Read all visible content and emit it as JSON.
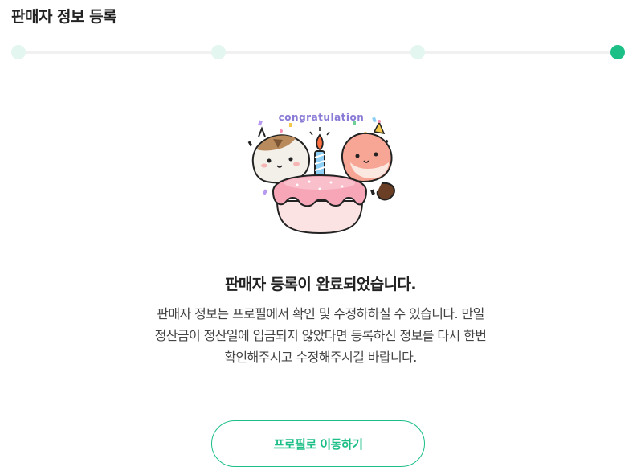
{
  "header": {
    "title": "판매자 정보 등록"
  },
  "stepper": {
    "total_steps": 4,
    "current_step": 4,
    "active_color": "#1cbf86",
    "inactive_color": "#e3f6ef"
  },
  "illustration": {
    "banner_text": "congratulation",
    "icon": "celebration-cake-with-two-hamsters"
  },
  "result": {
    "title": "판매자 등록이 완료되었습니다.",
    "description_lines": [
      "판매자 정보는 프로필에서 확인 및 수정하하실 수 있습니다. 만일",
      "정산금이 정산일에 입금되지 않았다면 등록하신 정보를 다시 한번",
      "확인해주시고 수정해주시길 바랍니다."
    ]
  },
  "actions": {
    "profile_button_label": "프로필로 이동하기"
  }
}
